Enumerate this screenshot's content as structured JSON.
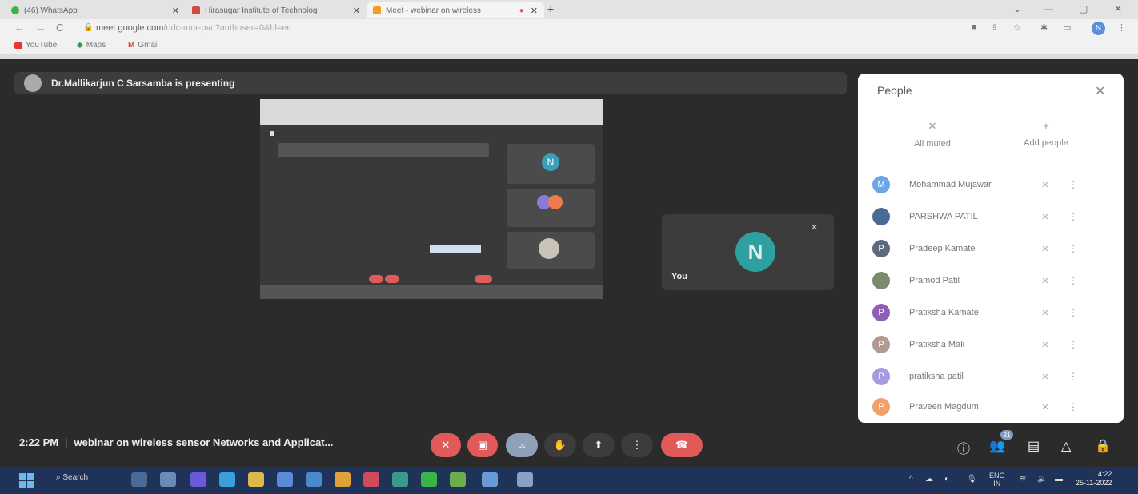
{
  "browser": {
    "tabs": [
      {
        "title": "(46) WhatsApp",
        "icon": "whatsapp-icon",
        "color": "#3bb34a"
      },
      {
        "title": "Hirasugar Institute of Technolog",
        "icon": "gmail-icon",
        "color": "#d04b3b"
      },
      {
        "title": "Meet - webinar on wireless",
        "icon": "meet-icon",
        "color": "#f0a01e"
      }
    ],
    "url_host": "meet.google.com",
    "url_path": "/ddc-mur-pvc?authuser=0&hl=en",
    "bookmarks": [
      "YouTube",
      "Maps",
      "Gmail"
    ],
    "profile_initial": "N"
  },
  "meet": {
    "presenting_text": "Dr.Mallikarjun C Sarsamba is presenting",
    "self_label": "You",
    "self_initial": "N",
    "time": "2:22 PM",
    "meeting_title": "webinar on wireless sensor Networks and Applicat...",
    "participant_count": "21"
  },
  "people_panel": {
    "title": "People",
    "actions": {
      "all_muted": "All muted",
      "add_people": "Add people"
    },
    "participants": [
      {
        "name": "Mohammad Mujawar",
        "initial": "M",
        "color": "#6ba6e6"
      },
      {
        "name": "PARSHWA PATIL",
        "initial": "",
        "color": "#4a6b95"
      },
      {
        "name": "Pradeep Kamate",
        "initial": "P",
        "color": "#5b6a7d"
      },
      {
        "name": "Pramod Patil",
        "initial": "",
        "color": "#7d8a6b"
      },
      {
        "name": "Pratiksha Kamate",
        "initial": "P",
        "color": "#8e5fb5"
      },
      {
        "name": "Pratiksha Mali",
        "initial": "P",
        "color": "#b39a91"
      },
      {
        "name": "pratiksha patil",
        "initial": "P",
        "color": "#a89ae0"
      },
      {
        "name": "Praveen Magdum",
        "initial": "P",
        "color": "#f0a06a"
      }
    ]
  },
  "taskbar": {
    "search_label": "Search",
    "lang": "ENG",
    "region": "IN",
    "time": "14:22",
    "date": "25-11-2022"
  }
}
